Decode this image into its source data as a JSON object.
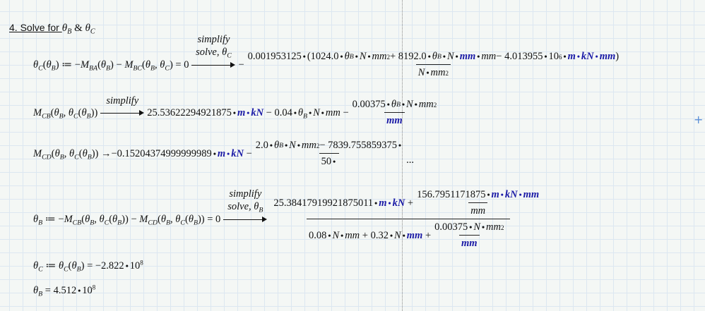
{
  "heading": {
    "label": "4. Solve for ",
    "vars": "θ_{B} & θ_{C}"
  },
  "row1": {
    "lhs": "θ_{C}(θ_{B}) ≔ −M_{BA}(θ_{B}) − M_{BC}(θ_{B}, θ_{C}) = 0",
    "arrow_top": "simplify",
    "arrow_bottom": "solve, θ_{C}",
    "sign": "−",
    "num": "0.001953125·(1024.0·θ_{B}·N·mm^{2} + 8192.0·θ_{B}·N·[mm]·mm − 4.013955·10^{6}·[m·kN·mm])",
    "den": "N·mm^{2}"
  },
  "row2": {
    "lhs": "M_{CB}(θ_{B}, θ_{C}(θ_{B}))",
    "arrow_top": "simplify",
    "rhs": "25.53622294921875·[m·kN] − 0.04·θ_{B}·N·mm −",
    "num": "0.00375·θ_{B}·N·mm^{2}",
    "den": "[mm]"
  },
  "row3": {
    "lhs": "M_{CD}(θ_{B}, θ_{C}(θ_{B})) → ",
    "rhs": "−0.15204374999999989·[m·kN] −",
    "num": "2.0·θ_{B}·N·mm^{2} − 7839.755859375·",
    "den": "50·",
    "ellipsis": "..."
  },
  "row4": {
    "lhs": "θ_{B} ≔ −M_{CB}(θ_{B}, θ_{C}(θ_{B})) − M_{CD}(θ_{B}, θ_{C}(θ_{B})) = 0",
    "arrow_top": "simplify",
    "arrow_bottom": "solve, θ_{B}",
    "num_text": "25.38417919921875011·[m·kN] +",
    "num_frac_num": "156.7951171875·[m·kN·mm]",
    "num_frac_den": "mm",
    "den_text": "0.08·N·mm + 0.32·N·[mm] +",
    "den_frac_num": "0.00375·N·mm^{2}",
    "den_frac_den": "[mm]"
  },
  "row5": {
    "expr": "θ_{C} ≔ θ_{C}(θ_{B}) = −2.822·10^{8}"
  },
  "row6": {
    "expr": "θ_{B} = 4.512·10^{8}"
  },
  "colors": {
    "unit": "#1a1aa6",
    "grid": "#dce7f1",
    "crosshair": "#5b8fd6"
  }
}
